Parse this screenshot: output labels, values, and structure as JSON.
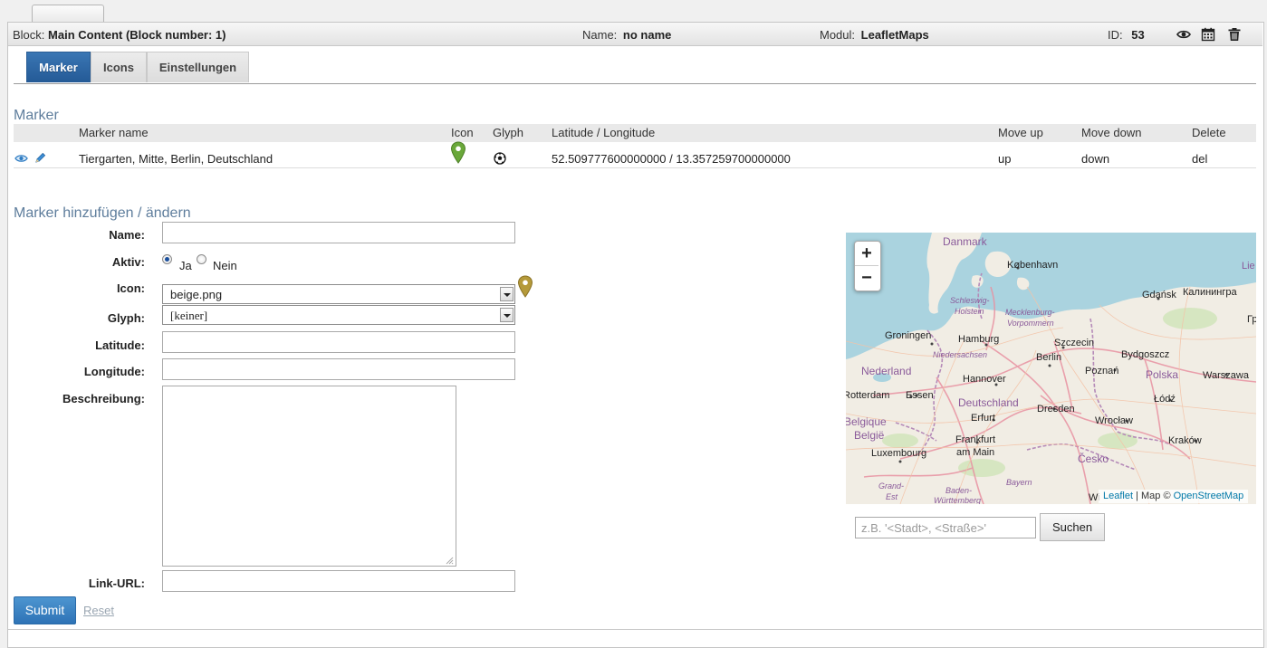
{
  "header": {
    "block_label": "Block:",
    "block_value": "Main Content (Block number: 1)",
    "name_label": "Name:",
    "name_value": "no name",
    "modul_label": "Modul:",
    "modul_value": "LeafletMaps",
    "id_label": "ID:",
    "id_value": "53"
  },
  "tabs": [
    {
      "label": "Marker",
      "active": true
    },
    {
      "label": "Icons",
      "active": false
    },
    {
      "label": "Einstellungen",
      "active": false
    }
  ],
  "marker_section": {
    "title": "Marker",
    "columns": [
      "Marker name",
      "Icon",
      "Glyph",
      "Latitude / Longitude",
      "Move up",
      "Move down",
      "Delete"
    ],
    "rows": [
      {
        "name": "Tiergarten, Mitte, Berlin, Deutschland",
        "icon": "green-map-pin-icon",
        "glyph": "football-icon",
        "latlng": "52.509777600000000 / 13.357259700000000",
        "move_up": "up",
        "move_down": "down",
        "delete": "del"
      }
    ]
  },
  "form": {
    "title": "Marker hinzufügen / ändern",
    "name_label": "Name:",
    "name_value": "",
    "aktiv_label": "Aktiv:",
    "aktiv_ja": "Ja",
    "aktiv_nein": "Nein",
    "aktiv_selected": "Ja",
    "icon_label": "Icon:",
    "icon_value": "beige.png",
    "glyph_label": "Glyph:",
    "glyph_value": "[keiner]",
    "latitude_label": "Latitude:",
    "latitude_value": "",
    "longitude_label": "Longitude:",
    "longitude_value": "",
    "beschreibung_label": "Beschreibung:",
    "beschreibung_value": "",
    "link_label": "Link-URL:",
    "link_value": "",
    "submit_label": "Submit",
    "reset_label": "Reset"
  },
  "map": {
    "zoom_in": "+",
    "zoom_out": "−",
    "attribution_leaflet": "Leaflet",
    "attribution_sep": " | Map © ",
    "attribution_osm": "OpenStreetMap",
    "partial_label": "Wi",
    "labels": {
      "danmark": "Danmark",
      "kobenhavn": "København",
      "gdansk": "Gdańsk",
      "kaliningrad": "Калинингра",
      "lie": "Lie",
      "gr": "Гр",
      "schleswig": "Schleswig-",
      "holstein": "Holstein",
      "mecklenburg": "Mecklenburg-",
      "vorpommern": "Vorpommern",
      "groningen": "Groningen",
      "hamburg": "Hamburg",
      "szczecin": "Szczecin",
      "bydgoszcz": "Bydgoszcz",
      "niedersachsen": "Niedersachsen",
      "nederland": "Nederland",
      "berlin": "Berlin",
      "poznan": "Poznań",
      "polska": "Polska",
      "warszawa": "Warszawa",
      "hannover": "Hannover",
      "rotterdam": "Rotterdam",
      "essen": "Essen",
      "deutschland": "Deutschland",
      "lodz": "Łódź",
      "dresden": "Dresden",
      "belgique": "Belgique",
      "erfurt": "Erfurt",
      "wroclaw": "Wrocław",
      "belgien": "België",
      "frankfurt": "Frankfurt",
      "am_main": "am Main",
      "krakow": "Kraków",
      "luxembourg": "Luxembourg",
      "cesko": "Česko",
      "bayern": "Bayern",
      "grand": "Grand-",
      "est": "Est",
      "baden": "Baden-",
      "wurttemberg": "Württemberg"
    },
    "search_placeholder": "z.B. '<Stadt>, <Straße>'",
    "search_button": "Suchen"
  },
  "colors": {
    "tab_active": "#2e68a8",
    "section_title": "#5e7d9c",
    "submit": "#3a84c4",
    "marker_green": "#6aa83a",
    "marker_beige": "#b59a3a",
    "map_water": "#aad3df",
    "map_land": "#f1ede4"
  }
}
